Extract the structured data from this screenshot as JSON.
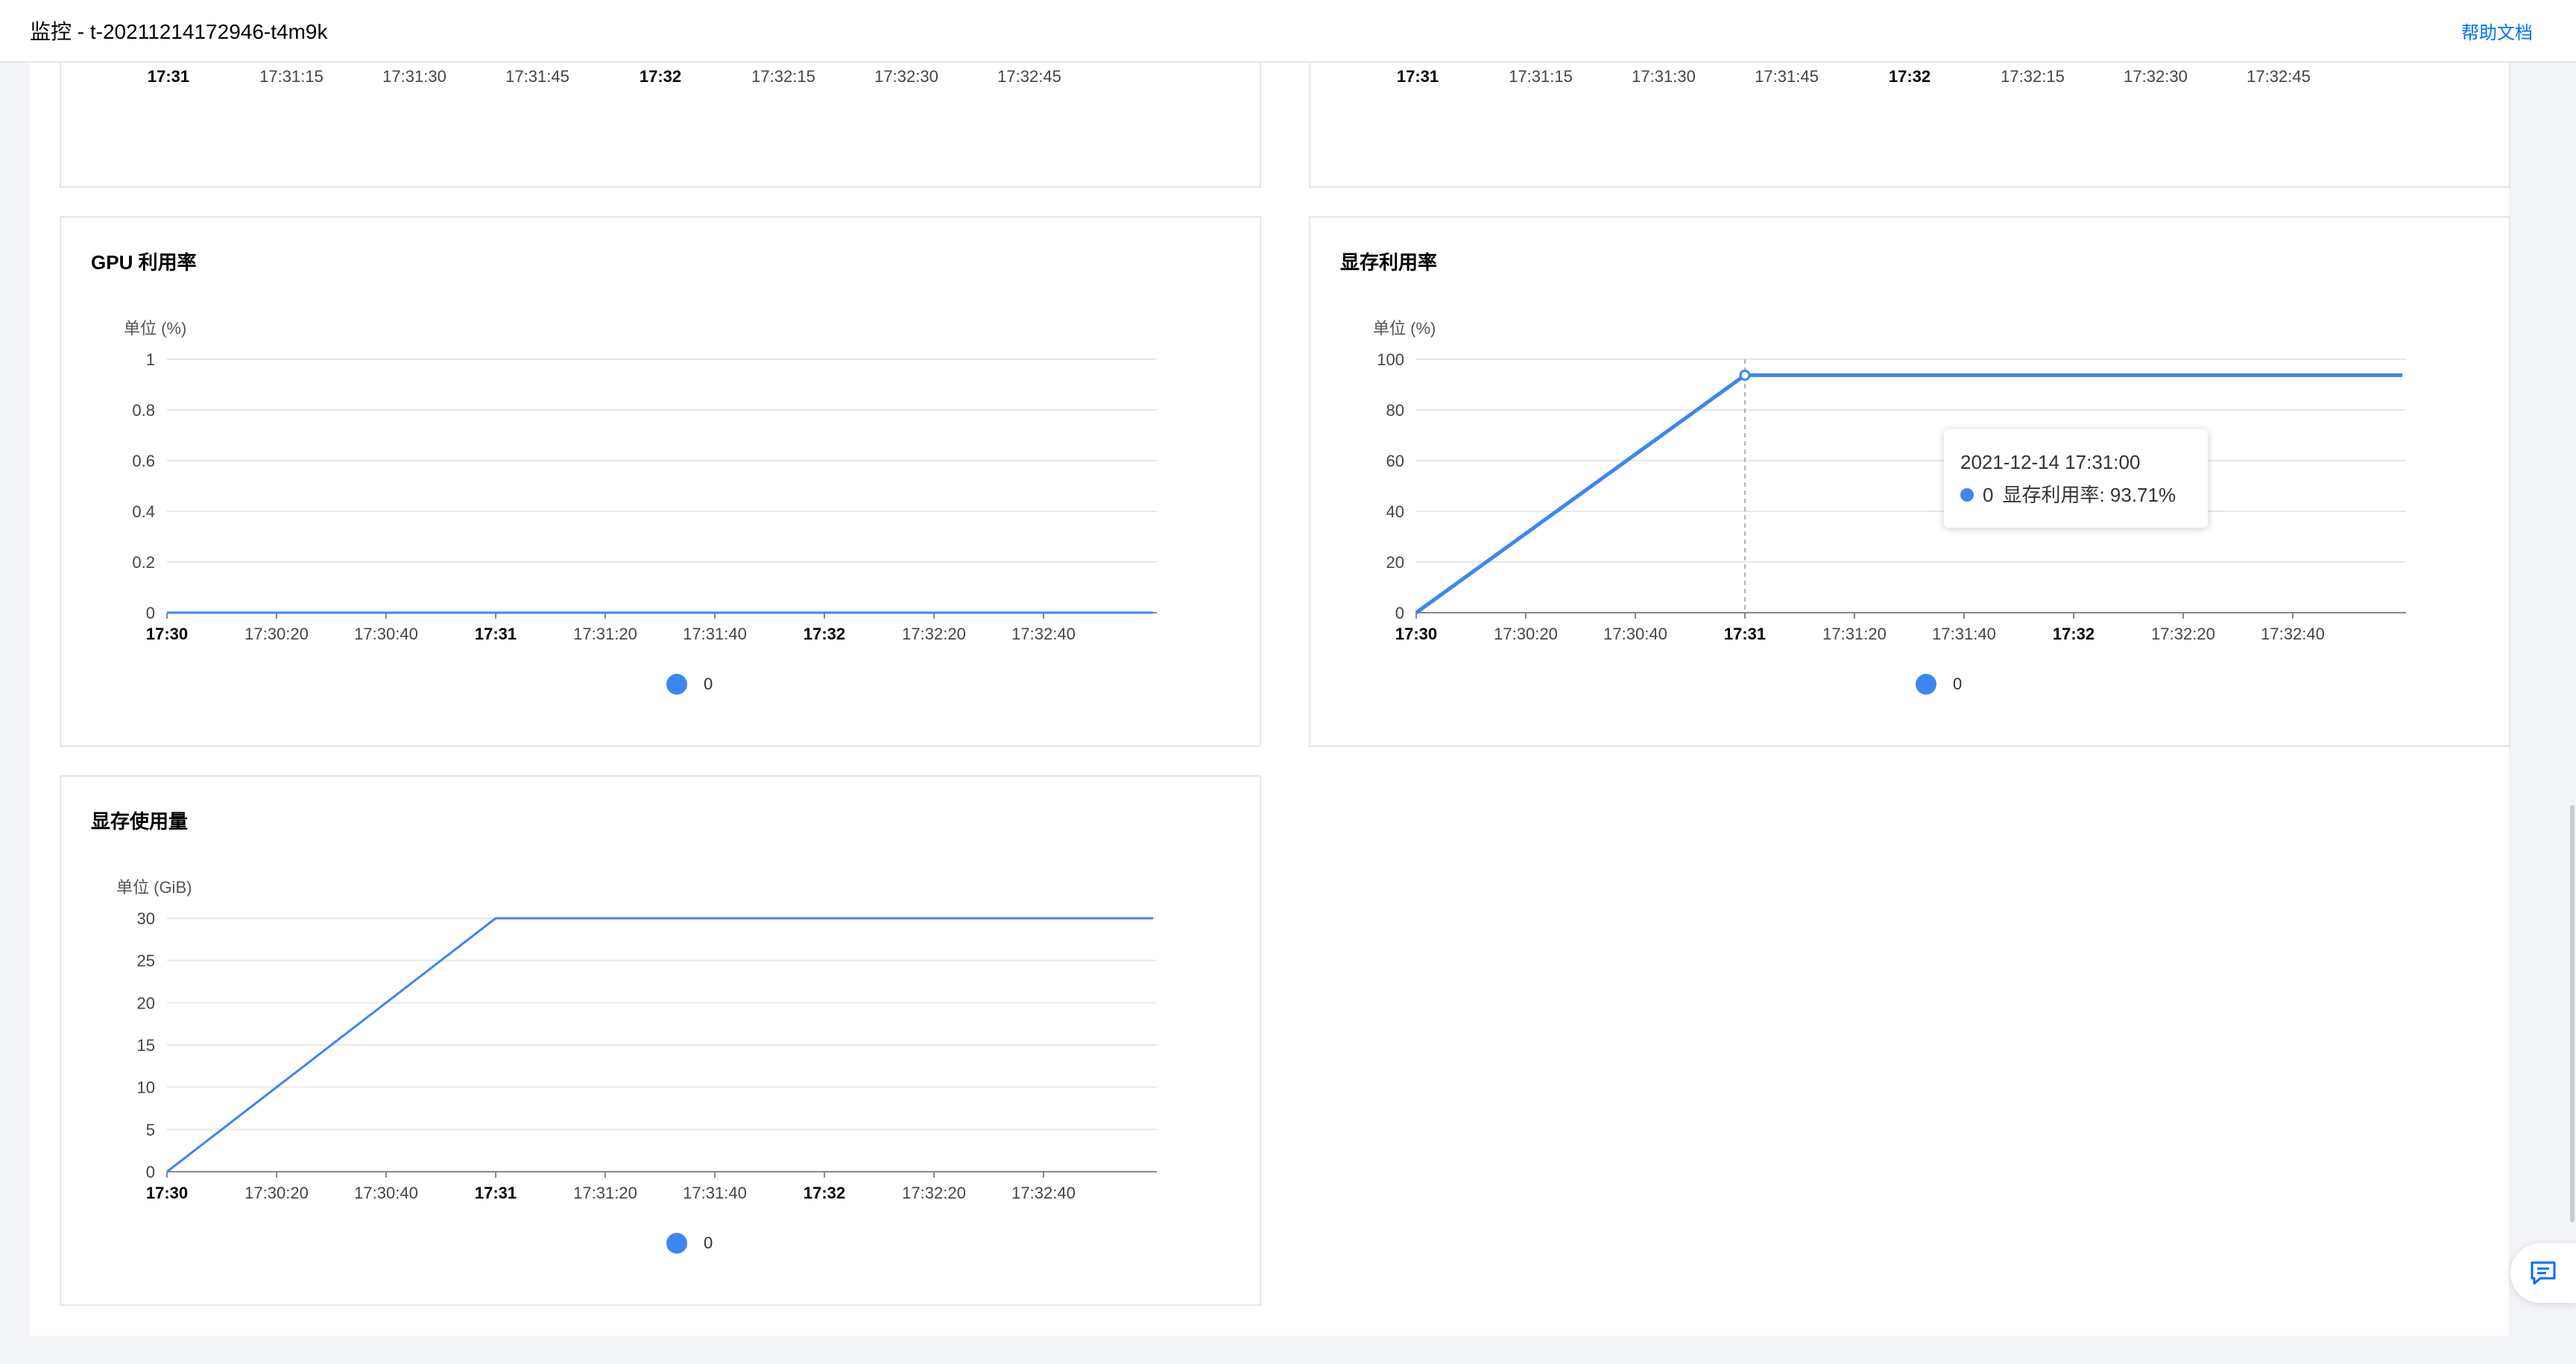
{
  "header": {
    "title": "监控 - t-20211214172946-t4m9k",
    "help_link": "帮助文档"
  },
  "colors": {
    "series": "#3d86f0",
    "grid": "#e8e9ec",
    "axis": "#888888"
  },
  "top_charts": [
    {
      "x_ticks": [
        "17:31",
        "17:31:15",
        "17:31:30",
        "17:31:45",
        "17:32",
        "17:32:15",
        "17:32:30",
        "17:32:45"
      ]
    },
    {
      "x_ticks": [
        "17:31",
        "17:31:15",
        "17:31:30",
        "17:31:45",
        "17:32",
        "17:32:15",
        "17:32:30",
        "17:32:45"
      ]
    }
  ],
  "charts": {
    "gpu_util": {
      "title": "GPU 利用率",
      "unit": "单位 (%)",
      "legend": "0",
      "chart_data": {
        "type": "line",
        "x": [
          "17:30",
          "17:31",
          "17:32",
          "17:33"
        ],
        "x_ticks": [
          "17:30",
          "17:30:20",
          "17:30:40",
          "17:31",
          "17:31:20",
          "17:31:40",
          "17:32",
          "17:32:20",
          "17:32:40"
        ],
        "y_ticks": [
          "0",
          "0.2",
          "0.4",
          "0.6",
          "0.8",
          "1"
        ],
        "ylim": [
          0,
          1
        ],
        "series": [
          {
            "name": "0",
            "values": [
              0,
              0,
              0,
              0
            ]
          }
        ]
      }
    },
    "mem_util": {
      "title": "显存利用率",
      "unit": "单位 (%)",
      "legend": "0",
      "tooltip": {
        "time": "2021-12-14 17:31:00",
        "series": "0",
        "label": "显存利用率: 93.71%"
      },
      "chart_data": {
        "type": "line",
        "x": [
          "17:30",
          "17:31",
          "17:32",
          "17:33"
        ],
        "x_ticks": [
          "17:30",
          "17:30:20",
          "17:30:40",
          "17:31",
          "17:31:20",
          "17:31:40",
          "17:32",
          "17:32:20",
          "17:32:40"
        ],
        "y_ticks": [
          "0",
          "20",
          "40",
          "60",
          "80",
          "100"
        ],
        "ylim": [
          0,
          100
        ],
        "series": [
          {
            "name": "0",
            "values": [
              0,
              93.71,
              93.71,
              93.71
            ]
          }
        ]
      }
    },
    "mem_usage": {
      "title": "显存使用量",
      "unit": "单位 (GiB)",
      "legend": "0",
      "chart_data": {
        "type": "line",
        "x": [
          "17:30",
          "17:31",
          "17:32",
          "17:33"
        ],
        "x_ticks": [
          "17:30",
          "17:30:20",
          "17:30:40",
          "17:31",
          "17:31:20",
          "17:31:40",
          "17:32",
          "17:32:20",
          "17:32:40"
        ],
        "y_ticks": [
          "0",
          "5",
          "10",
          "15",
          "20",
          "25",
          "30"
        ],
        "ylim": [
          0,
          30
        ],
        "series": [
          {
            "name": "0",
            "values": [
              0,
              30,
              30,
              30
            ]
          }
        ]
      }
    }
  }
}
